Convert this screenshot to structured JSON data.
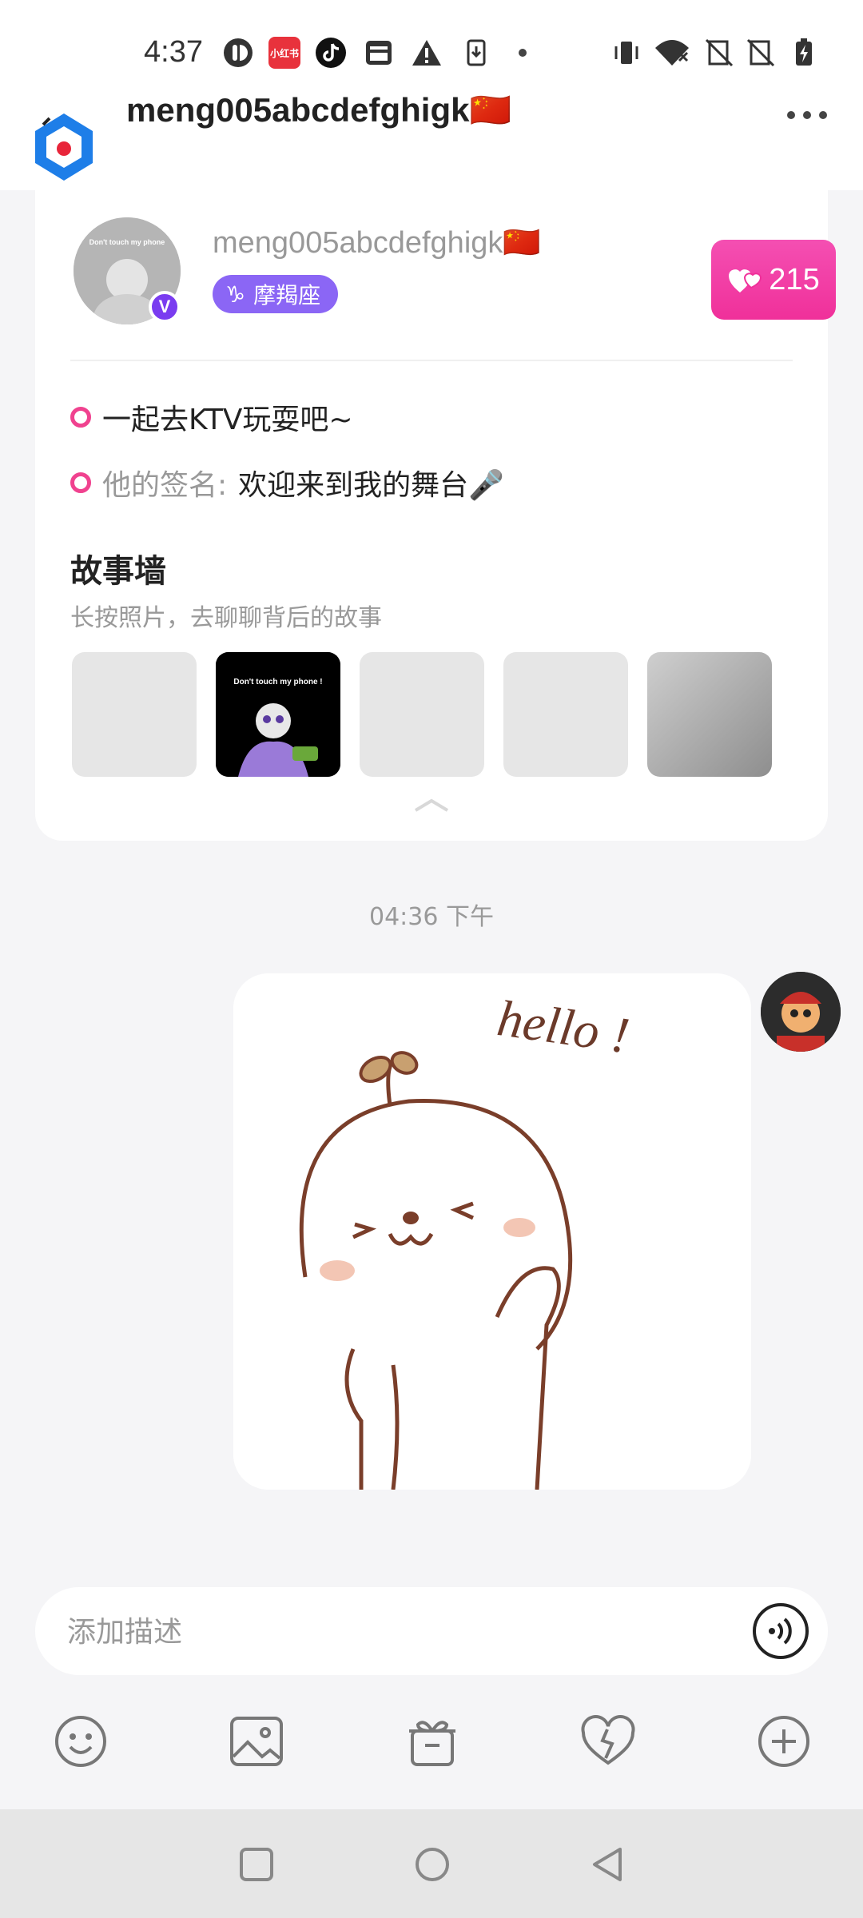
{
  "status_bar": {
    "time": "4:37",
    "left_icons": [
      "app-notification-icon",
      "xiaohongshu-icon",
      "tiktok-icon",
      "window-icon",
      "warning-icon",
      "download-icon",
      "dot-icon"
    ],
    "right_icons": [
      "vibrate-icon",
      "wifi-icon",
      "no-sim-icon",
      "no-sim-icon",
      "battery-charging-icon"
    ],
    "xiaohongshu_label": "小红书"
  },
  "header": {
    "title": "meng005abcdefghigk🇨🇳",
    "more_icon": "more-icon"
  },
  "profile": {
    "name": "meng005abcdefghigk🇨🇳",
    "verified_badge": "V",
    "zodiac_symbol": "♑",
    "zodiac": "摩羯座",
    "likes": "215",
    "status_line": "一起去KTV玩耍吧~",
    "signature_label": "他的签名:",
    "signature": "欢迎来到我的舞台🎤",
    "avatar_caption": "Don't touch my phone"
  },
  "story_wall": {
    "title": "故事墙",
    "subtitle": "长按照片，去聊聊背后的故事",
    "photo_caption": "Don't touch my phone !"
  },
  "chat": {
    "timestamp": "04:36 下午",
    "sticker_text": "hello !"
  },
  "composer": {
    "placeholder": "添加描述"
  },
  "toolbar": {
    "items": [
      "emoji-icon",
      "image-icon",
      "gift-icon",
      "heart-icon",
      "plus-icon"
    ]
  },
  "colors": {
    "accent_pink": "#f0309a",
    "zodiac_purple": "#8b66f5",
    "dot_pink": "#f0428f"
  }
}
